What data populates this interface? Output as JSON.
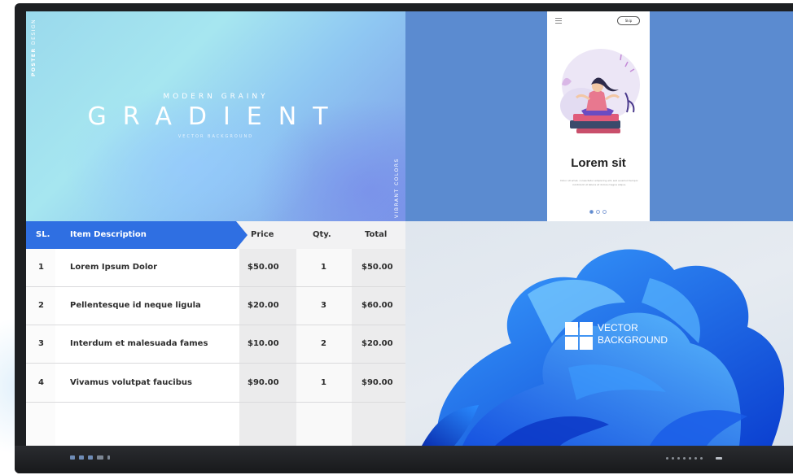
{
  "poster": {
    "side_strong": "POSTER",
    "side_rest": " DESIGN",
    "kicker": "MODERN GRAINY",
    "headline": "GRADIENT",
    "subline": "VECTOR BACKGROUND",
    "vertical_right": "VIBRANT COLORS"
  },
  "mobile": {
    "skip_label": "Skip",
    "title": "Lorem sit",
    "body": "Dolor sit amet, consectetur adipiscing elit, sed eiusmod tempor incididunt ut labore et dolore magna aliqua.",
    "page_count": 3,
    "active_page": 1
  },
  "invoice": {
    "headers": {
      "sl": "SL.",
      "description": "Item Description",
      "price": "Price",
      "qty": "Qty.",
      "total": "Total"
    },
    "rows": [
      {
        "sl": "1",
        "description": "Lorem Ipsum Dolor",
        "price": "$50.00",
        "qty": "1",
        "total": "$50.00"
      },
      {
        "sl": "2",
        "description": "Pellentesque id neque ligula",
        "price": "$20.00",
        "qty": "3",
        "total": "$60.00"
      },
      {
        "sl": "3",
        "description": "Interdum et malesuada fames",
        "price": "$10.00",
        "qty": "2",
        "total": "$20.00"
      },
      {
        "sl": "4",
        "description": "Vivamus volutpat faucibus",
        "price": "$90.00",
        "qty": "1",
        "total": "$90.00"
      }
    ]
  },
  "wallpaper": {
    "line1": "VECTOR",
    "line2": "BACKGROUND"
  },
  "colors": {
    "accent_blue": "#2f6fe2",
    "panel_blue": "#5b8bd0",
    "bezel": "#1d1f22"
  }
}
